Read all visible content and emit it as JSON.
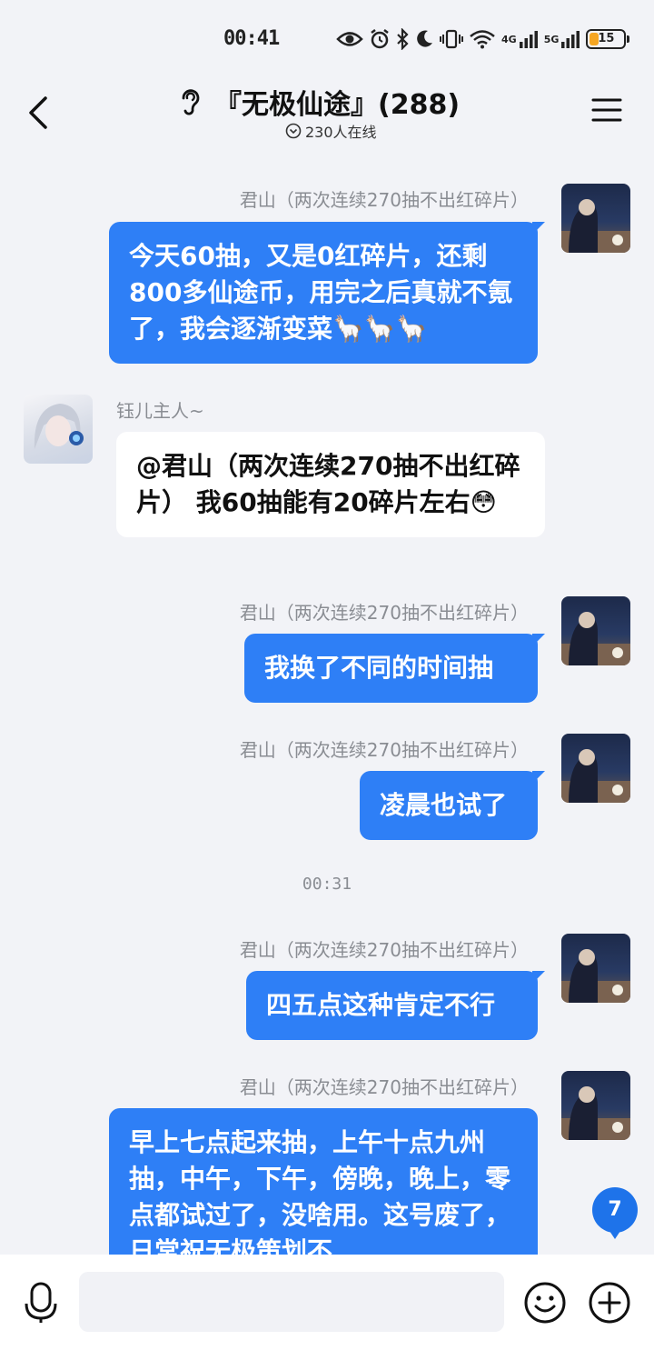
{
  "status_bar": {
    "time": "00:41",
    "signal_labels": [
      "4G",
      "5G"
    ],
    "battery_level": "15"
  },
  "header": {
    "title": "『无极仙途』(288)",
    "online": "230人在线"
  },
  "messages": [
    {
      "sender": "君山（两次连续270抽不出红碎片）",
      "text": "今天60抽，又是0红碎片，还剩800多仙途币，用完之后真就不氪了，我会逐渐变菜🦙🦙🦙",
      "direction": "out"
    },
    {
      "sender": "钰儿主人~",
      "text": "@君山（两次连续270抽不出红碎片） 我60抽能有20碎片左右😳",
      "direction": "in"
    },
    {
      "sender": "君山（两次连续270抽不出红碎片）",
      "text": "我换了不同的时间抽",
      "direction": "out"
    },
    {
      "sender": "君山（两次连续270抽不出红碎片）",
      "text": "凌晨也试了",
      "direction": "out"
    },
    {
      "sender": "君山（两次连续270抽不出红碎片）",
      "text": "四五点这种肯定不行",
      "direction": "out"
    },
    {
      "sender": "君山（两次连续270抽不出红碎片）",
      "text": "早上七点起来抽，上午十点九州抽，中午，下午，傍晚，晚上，零点都试过了，没啥用。这号废了，日常祝无极策划不",
      "direction": "out"
    }
  ],
  "timestamp": "00:31",
  "unread_count": "7",
  "input": {
    "value": "",
    "placeholder": ""
  },
  "colors": {
    "outgoing_bubble": "#2e7ff6",
    "incoming_bubble": "#ffffff",
    "background": "#f2f3f7",
    "badge": "#1e73ea"
  }
}
